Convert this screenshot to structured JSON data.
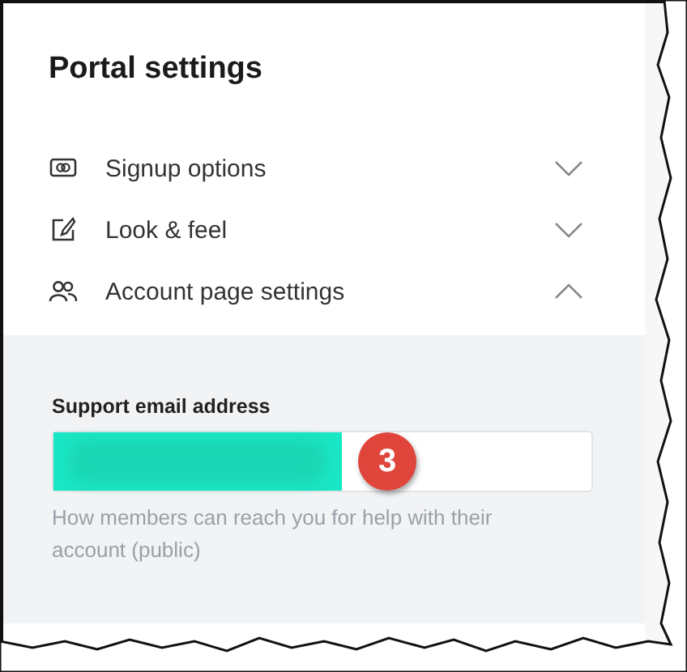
{
  "title": "Portal settings",
  "sections": [
    {
      "kind": "toggle",
      "label": "Signup options",
      "expanded": false
    },
    {
      "kind": "brush",
      "label": "Look & feel",
      "expanded": false
    },
    {
      "kind": "people",
      "label": "Account page settings",
      "expanded": true,
      "field": {
        "label": "Support email address",
        "redacted": true,
        "hint": "How members can reach you for help with their account (public)"
      }
    }
  ],
  "annotation": {
    "number": "3"
  }
}
